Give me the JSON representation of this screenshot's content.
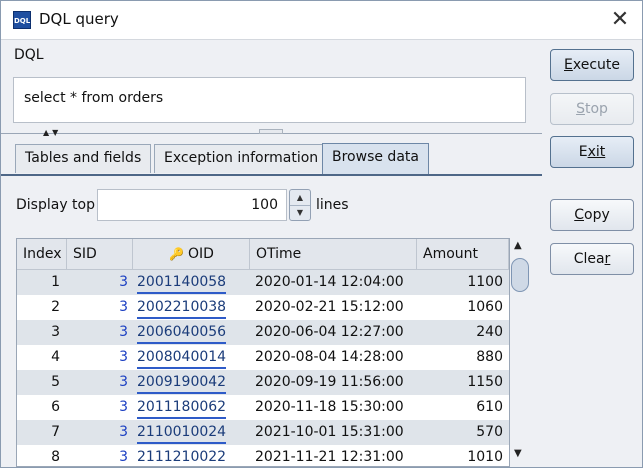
{
  "window": {
    "title": "DQL query",
    "icon_text": "DQL"
  },
  "query": {
    "label": "DQL",
    "text": "select * from orders"
  },
  "tabs": [
    {
      "label": "Tables and fields"
    },
    {
      "label": "Exception information"
    },
    {
      "label": "Browse data",
      "active": true
    }
  ],
  "controls": {
    "display_top_label": "Display top",
    "display_top_value": "100",
    "lines_label": "lines"
  },
  "buttons": {
    "execute": {
      "first": "E",
      "rest": "xecute"
    },
    "stop": {
      "first": "S",
      "rest": "top"
    },
    "exit": {
      "first": "E",
      "rest": "xit"
    },
    "copy": {
      "first": "C",
      "rest": "opy"
    },
    "clear": {
      "first": "Clea",
      "mid": "r",
      "rest": ""
    }
  },
  "table": {
    "columns": [
      "Index",
      "SID",
      "OID",
      "OTime",
      "Amount"
    ],
    "rows": [
      {
        "index": "1",
        "sid": "3",
        "oid": "2001140058",
        "otime": "2020-01-14 12:04:00",
        "amount": "1100"
      },
      {
        "index": "2",
        "sid": "3",
        "oid": "2002210038",
        "otime": "2020-02-21 15:12:00",
        "amount": "1060"
      },
      {
        "index": "3",
        "sid": "3",
        "oid": "2006040056",
        "otime": "2020-06-04 12:27:00",
        "amount": "240"
      },
      {
        "index": "4",
        "sid": "3",
        "oid": "2008040014",
        "otime": "2020-08-04 14:28:00",
        "amount": "880"
      },
      {
        "index": "5",
        "sid": "3",
        "oid": "2009190042",
        "otime": "2020-09-19 11:56:00",
        "amount": "1150"
      },
      {
        "index": "6",
        "sid": "3",
        "oid": "2011180062",
        "otime": "2020-11-18 15:30:00",
        "amount": "610"
      },
      {
        "index": "7",
        "sid": "3",
        "oid": "2110010024",
        "otime": "2021-10-01 15:31:00",
        "amount": "570"
      },
      {
        "index": "8",
        "sid": "3",
        "oid": "2111210022",
        "otime": "2021-11-21 12:31:00",
        "amount": "1010"
      }
    ]
  },
  "colors": {
    "accent": "#4e6787",
    "link": "#1b3fc2",
    "row_alt": "#dfe4ea"
  }
}
